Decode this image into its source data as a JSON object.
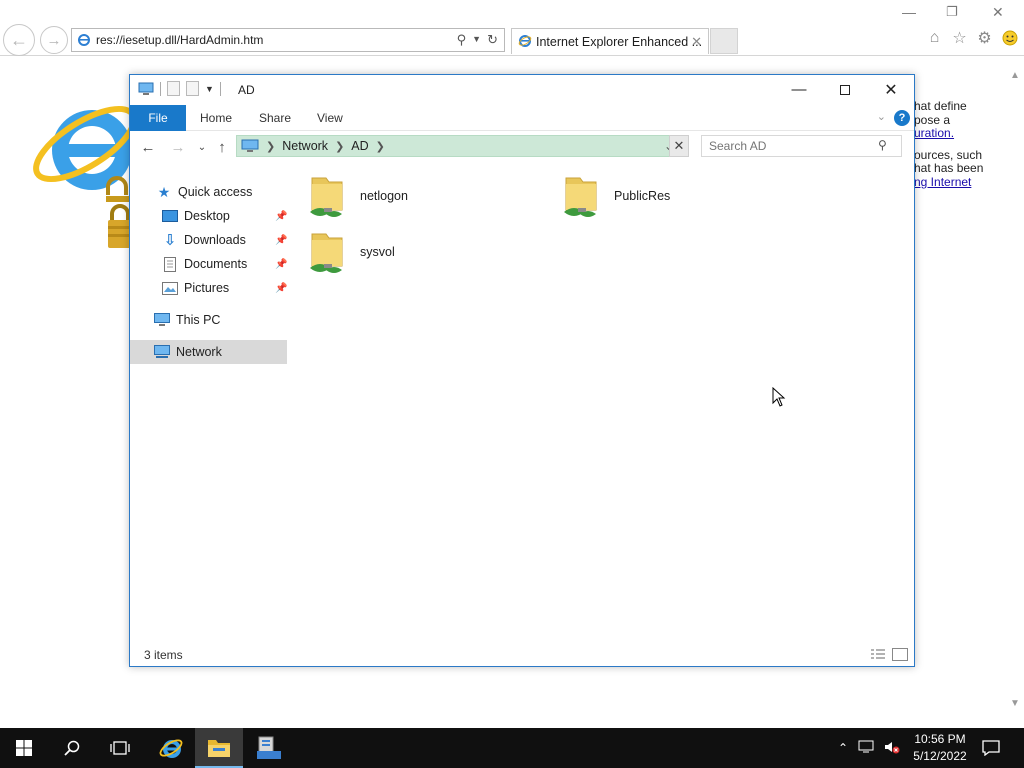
{
  "browser": {
    "address": "res://iesetup.dll/HardAdmin.htm",
    "tab_title": "Internet Explorer Enhanced ...",
    "page_text_lines": [
      "hat define",
      "pose a",
      "uration.",
      "",
      "ources, such",
      "hat has been",
      "ng Internet"
    ]
  },
  "explorer": {
    "title": "AD",
    "ribbon_tabs": [
      "File",
      "Home",
      "Share",
      "View"
    ],
    "breadcrumb": [
      "Network",
      "AD"
    ],
    "search_placeholder": "Search AD",
    "nav": {
      "quick_access": "Quick access",
      "desktop": "Desktop",
      "downloads": "Downloads",
      "documents": "Documents",
      "pictures": "Pictures",
      "this_pc": "This PC",
      "network": "Network"
    },
    "items": [
      "netlogon",
      "PublicRes",
      "sysvol"
    ],
    "status": "3 items"
  },
  "taskbar": {
    "time": "10:56 PM",
    "date": "5/12/2022"
  },
  "colors": {
    "accent": "#1979ca",
    "breadcrumb_bg": "#cde8d7",
    "taskbar": "#101010"
  }
}
